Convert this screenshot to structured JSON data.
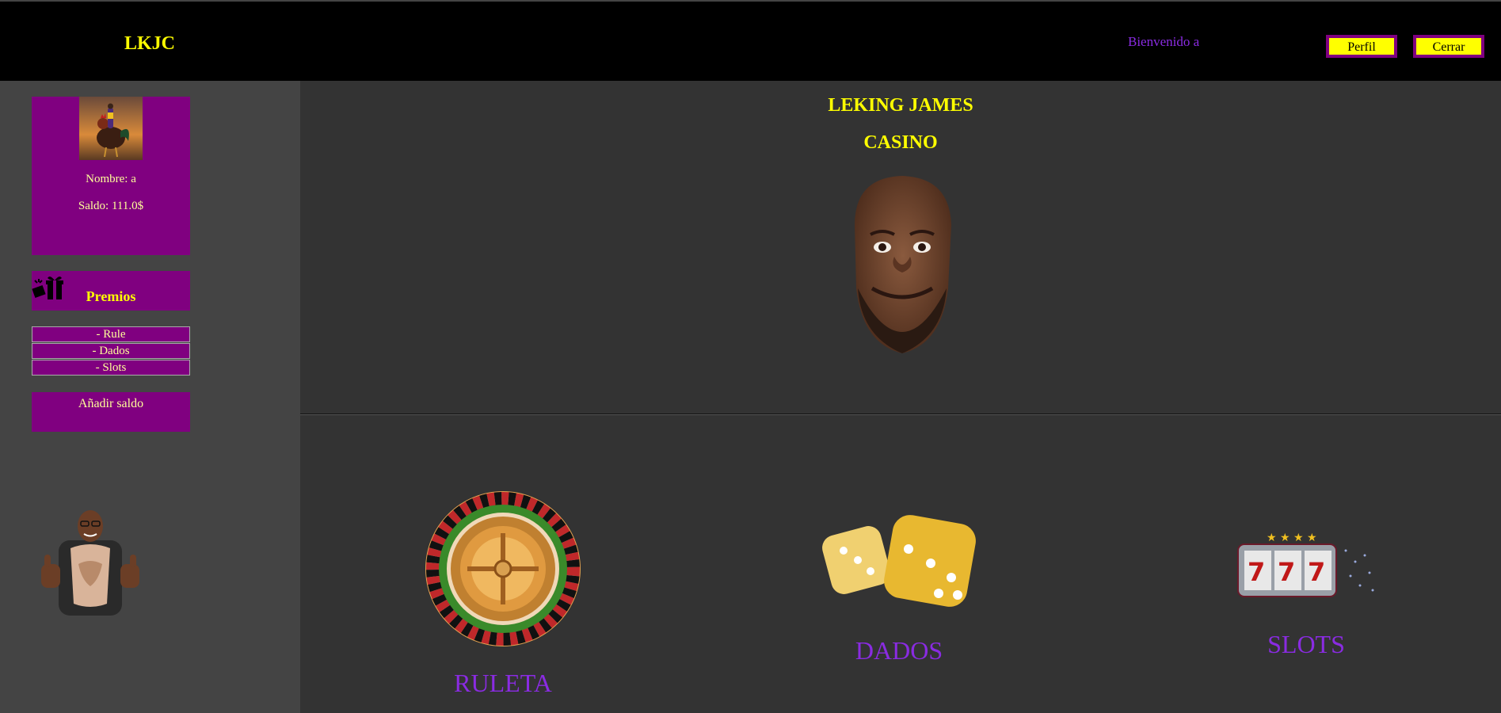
{
  "header": {
    "brand": "LKJC",
    "welcome": "Bienvenido a",
    "profile_button": "Perfil",
    "logout_button": "Cerrar"
  },
  "sidebar": {
    "profile": {
      "name": "Nombre: a",
      "balance": "Saldo: 111.0$"
    },
    "prizes_label": "Premios",
    "games": [
      {
        "label": "- Rule"
      },
      {
        "label": "- Dados"
      },
      {
        "label": "- Slots"
      }
    ],
    "add_funds": "Añadir saldo"
  },
  "hero": {
    "title_line1": "LEKING JAMES",
    "title_line2": "CASINO"
  },
  "games": {
    "roulette": "RULETA",
    "dice": "DADOS",
    "slots": "SLOTS"
  },
  "colors": {
    "accent_yellow": "#ffff00",
    "accent_purple": "#800080",
    "link_violet": "#8a2be2"
  }
}
